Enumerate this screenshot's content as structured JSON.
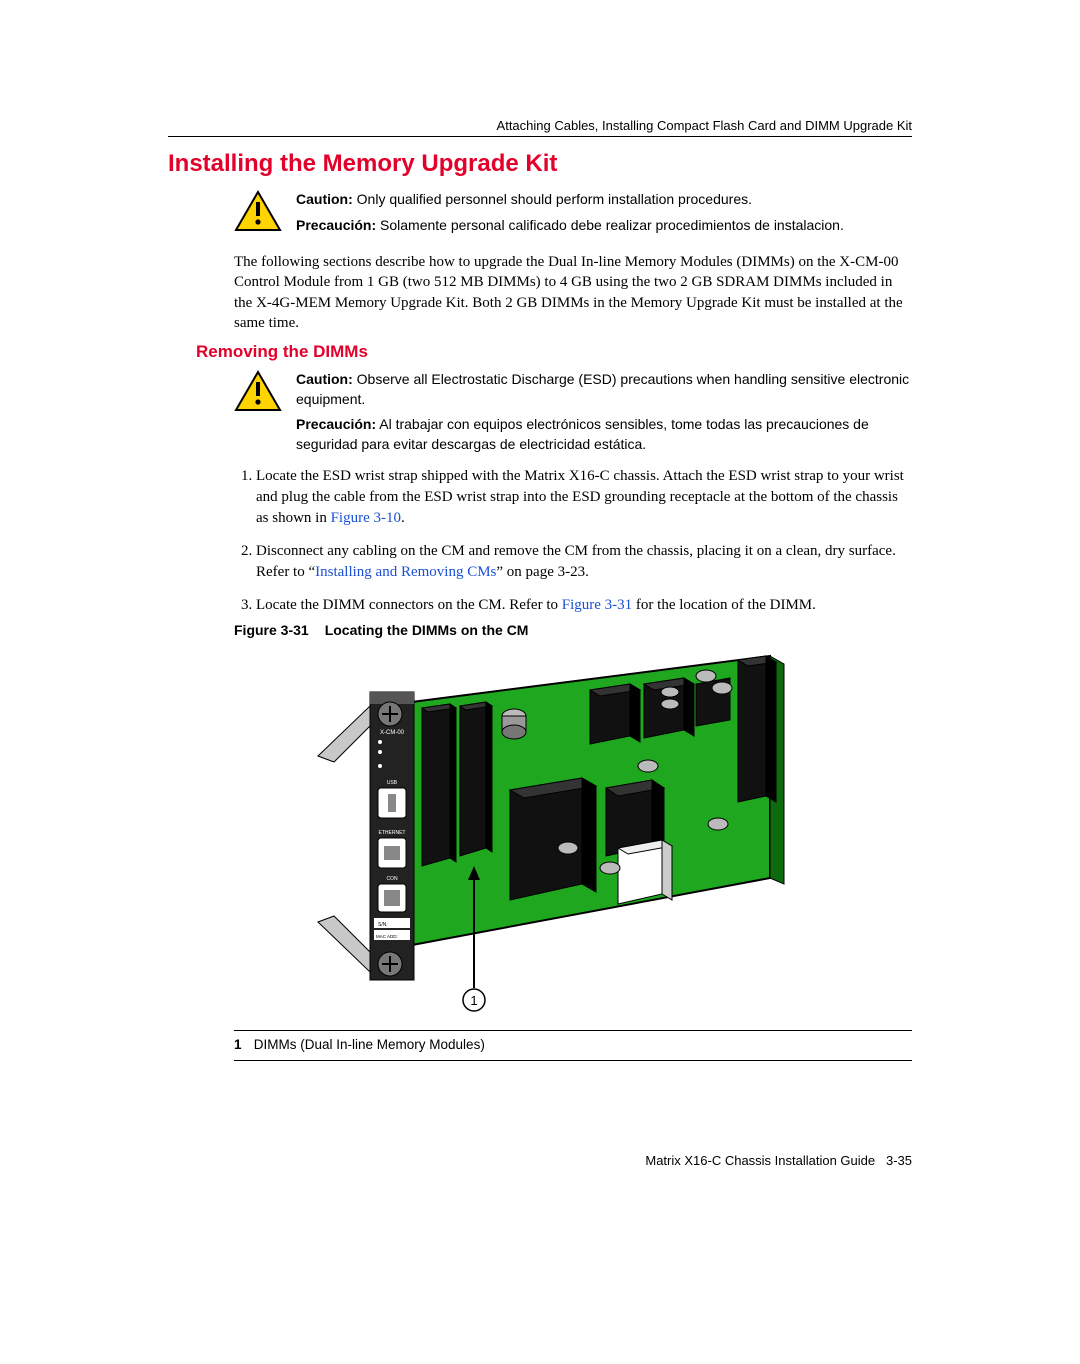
{
  "running_head": "Attaching Cables, Installing Compact Flash Card and DIMM Upgrade Kit",
  "h1": "Installing the Memory Upgrade Kit",
  "caution1": {
    "en_label": "Caution:",
    "en_text": " Only qualified personnel should perform installation procedures.",
    "es_label": "Precaución:",
    "es_text": " Solamente personal calificado debe realizar procedimientos de instalacion."
  },
  "intro_para": "The following sections describe how to upgrade the Dual In-line Memory Modules (DIMMs) on the X-CM-00 Control Module from 1 GB (two 512 MB DIMMs) to 4 GB using the two 2 GB SDRAM DIMMs included in the X-4G-MEM Memory Upgrade Kit. Both 2 GB DIMMs in the Memory Upgrade Kit must be installed at the same time.",
  "h2": "Removing the DIMMs",
  "caution2": {
    "en_label": "Caution:",
    "en_text": " Observe all Electrostatic Discharge (ESD) precautions when handling sensitive electronic equipment.",
    "es_label": "Precaución:",
    "es_text": " Al trabajar con equipos electrónicos sensibles, tome todas las precauciones de seguridad para evitar descargas de electricidad estática."
  },
  "steps": {
    "s1a": "Locate the ESD wrist strap shipped with the Matrix X16-C chassis. Attach the ESD wrist strap to your wrist and plug the cable from the ESD wrist strap into the ESD grounding receptacle at the bottom of the chassis as shown in ",
    "s1_link": "Figure 3-10",
    "s1b": ".",
    "s2a": "Disconnect any cabling on the CM and remove the CM from the chassis, placing it on a clean, dry surface. Refer to “",
    "s2_link": "Installing and Removing CMs",
    "s2b": "” on page 3-23.",
    "s3a": "Locate the DIMM connectors on the CM. Refer to ",
    "s3_link": "Figure 3-31",
    "s3b": " for the location of the DIMM."
  },
  "figure": {
    "num": "Figure 3-31",
    "title": "Locating the DIMMs on the CM"
  },
  "callout": {
    "num": "1",
    "text": "DIMMs (Dual In-line Memory Modules)"
  },
  "footer": {
    "book": "Matrix X16-C Chassis Installation Guide",
    "page": "3-35"
  },
  "board_label": "X-CM-00",
  "port_labels": {
    "usb": "USB",
    "eth": "ETHERNET",
    "con": "CON",
    "sn": "S/N:",
    "mac": "MAC ADD:"
  },
  "circle_one": "1"
}
